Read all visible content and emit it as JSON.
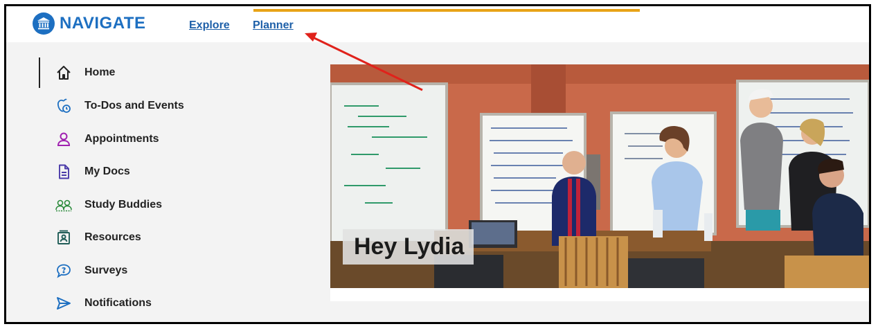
{
  "header": {
    "logo_text": "NAVIGATE",
    "links": [
      {
        "label": "Explore"
      },
      {
        "label": "Planner"
      }
    ]
  },
  "sidebar": {
    "items": [
      {
        "label": "Home",
        "icon": "home-icon",
        "active": true
      },
      {
        "label": "To-Dos and Events",
        "icon": "todo-clock-icon"
      },
      {
        "label": "Appointments",
        "icon": "person-icon"
      },
      {
        "label": "My Docs",
        "icon": "document-icon"
      },
      {
        "label": "Study Buddies",
        "icon": "study-buddies-icon"
      },
      {
        "label": "Resources",
        "icon": "resources-icon"
      },
      {
        "label": "Surveys",
        "icon": "speech-bubble-icon"
      },
      {
        "label": "Notifications",
        "icon": "paper-plane-icon"
      }
    ]
  },
  "hero": {
    "greeting": "Hey Lydia"
  },
  "colors": {
    "brand": "#1d6fc1",
    "accent": "#e8a317",
    "annotation_arrow": "#e0221b"
  }
}
